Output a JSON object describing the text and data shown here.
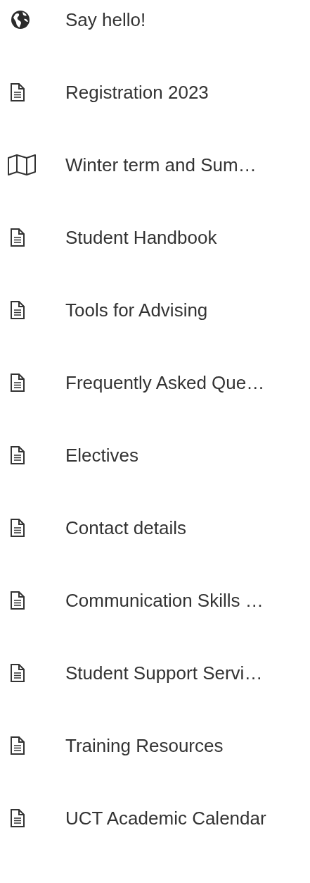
{
  "menu": {
    "items": [
      {
        "kind": "globe",
        "label": "Say hello!"
      },
      {
        "kind": "document",
        "label": "Registration 2023"
      },
      {
        "kind": "map",
        "label": "Winter term and Sum…"
      },
      {
        "kind": "document",
        "label": "Student Handbook"
      },
      {
        "kind": "document",
        "label": "Tools for Advising"
      },
      {
        "kind": "document",
        "label": "Frequently Asked Que…"
      },
      {
        "kind": "document",
        "label": "Electives"
      },
      {
        "kind": "document",
        "label": "Contact details"
      },
      {
        "kind": "document",
        "label": "Communication Skills …"
      },
      {
        "kind": "document",
        "label": "Student Support Servi…"
      },
      {
        "kind": "document",
        "label": "Training Resources"
      },
      {
        "kind": "document",
        "label": "UCT Academic Calendar"
      }
    ]
  }
}
